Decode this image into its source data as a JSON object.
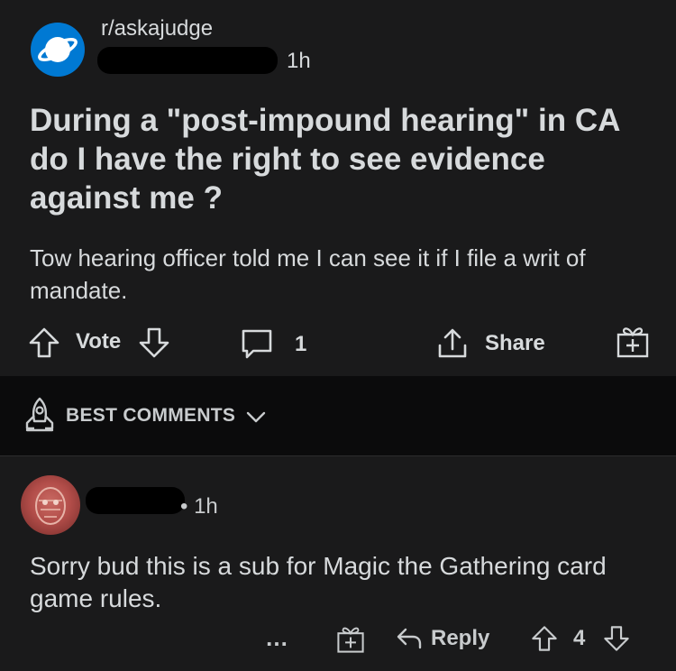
{
  "post": {
    "subreddit": "r/askajudge",
    "time": "1h",
    "title": "During a \"post-impound hearing\" in CA do I have the right to see evidence against me ?",
    "body": "Tow hearing officer told me I can see it if I file a writ of mandate.",
    "actions": {
      "vote_label": "Vote",
      "comment_count": "1",
      "share_label": "Share"
    }
  },
  "sort": {
    "label": "BEST COMMENTS"
  },
  "comment": {
    "meta": "• 1h",
    "body": "Sorry bud this is a sub for Magic the Gathering card game rules.",
    "more_label": "…",
    "reply_label": "Reply",
    "score": "4"
  },
  "colors": {
    "background": "#1a1a1b",
    "sort_bar": "#0b0b0c",
    "text": "#d7dadc",
    "subreddit_icon": "#0079d3"
  }
}
